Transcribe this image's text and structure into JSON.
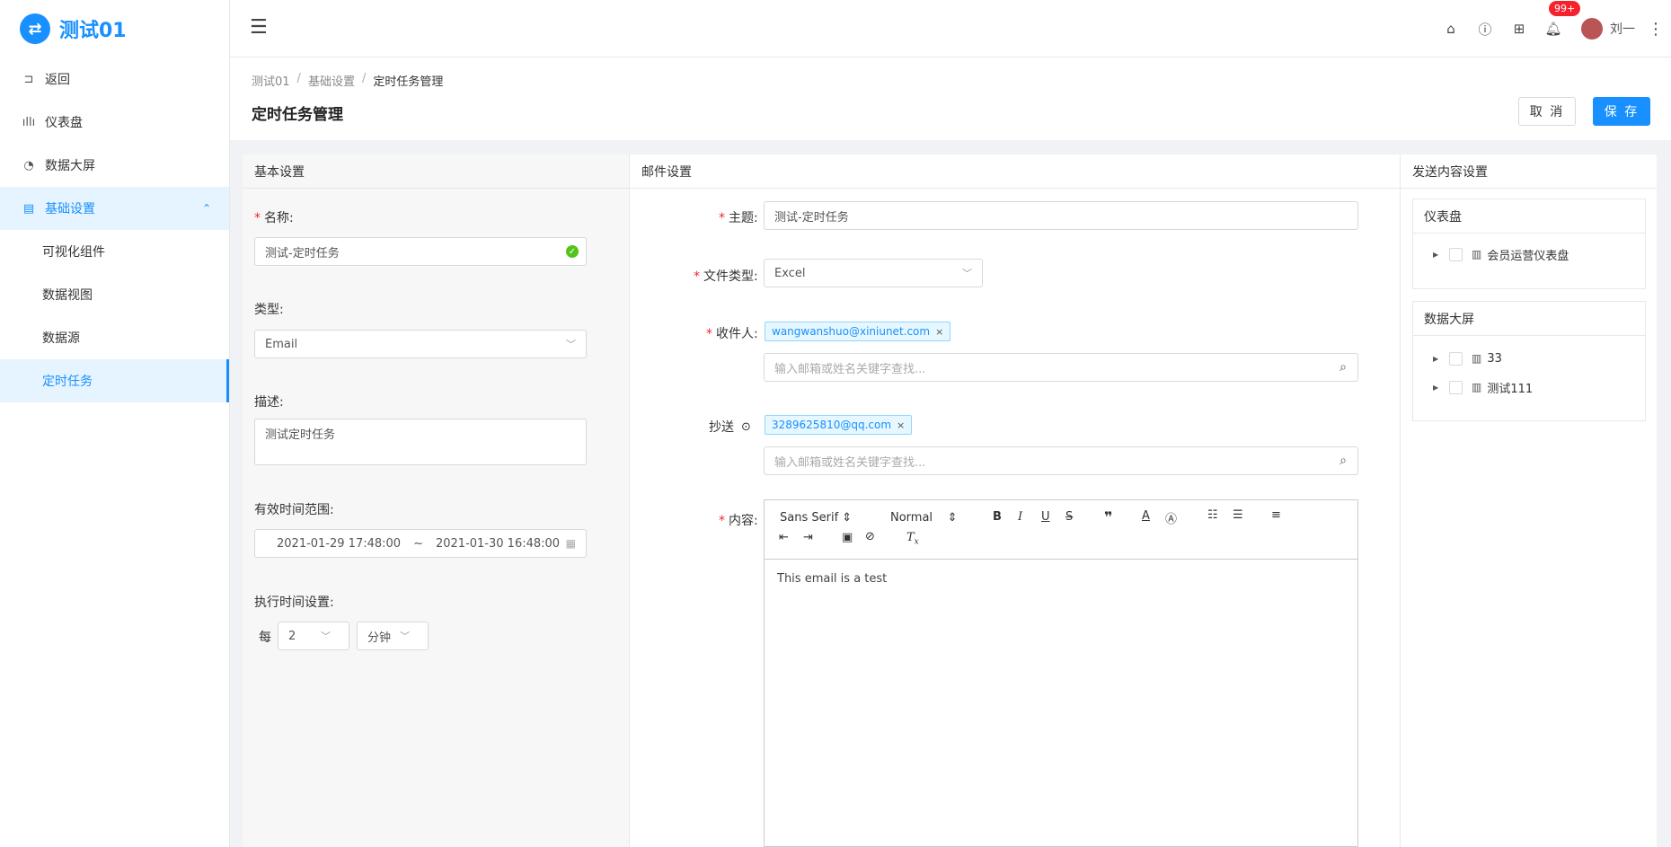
{
  "app": {
    "logo_glyph": "⇄",
    "title": "测试01"
  },
  "sidebar": {
    "items": [
      {
        "label": "返回",
        "icon": "back-icon"
      },
      {
        "label": "仪表盘",
        "icon": "dashboard-icon"
      },
      {
        "label": "数据大屏",
        "icon": "pie-chart-icon"
      },
      {
        "label": "基础设置",
        "icon": "settings-doc-icon"
      }
    ],
    "subitems": [
      "可视化组件",
      "数据视图",
      "数据源",
      "定时任务"
    ]
  },
  "header": {
    "notification_badge": "99+",
    "username": "刘一"
  },
  "breadcrumb": {
    "items": [
      "测试01",
      "基础设置",
      "定时任务管理"
    ]
  },
  "page": {
    "title": "定时任务管理",
    "cancel_label": "取 消",
    "save_label": "保 存"
  },
  "basic": {
    "header": "基本设置",
    "name_label": "名称:",
    "name_value": "测试-定时任务",
    "type_label": "类型:",
    "type_value": "Email",
    "desc_label": "描述:",
    "desc_value": "测试定时任务",
    "range_label": "有效时间范围:",
    "range_start": "2021-01-29 17:48:00",
    "range_sep": "~",
    "range_end": "2021-01-30 16:48:00",
    "exec_label": "执行时间设置:",
    "every_label": "每",
    "every_value": "2",
    "unit_value": "分钟"
  },
  "mail": {
    "header": "邮件设置",
    "subject_label": "主题:",
    "subject_value": "测试-定时任务",
    "filetype_label": "文件类型:",
    "filetype_value": "Excel",
    "to_label": "收件人:",
    "to_tag": "wangwanshuo@xiniunet.com",
    "to_placeholder": "输入邮箱或姓名关键字查找...",
    "cc_label": "抄送",
    "cc_tag": "3289625810@qq.com",
    "cc_placeholder": "输入邮箱或姓名关键字查找...",
    "content_label": "内容:",
    "font_value": "Sans Serif",
    "size_value": "Normal",
    "content_value": "This email is a test"
  },
  "send_content": {
    "header": "发送内容设置",
    "dashboard_title": "仪表盘",
    "dashboard_items": [
      "会员运营仪表盘"
    ],
    "screen_title": "数据大屏",
    "screen_items": [
      "33",
      "测试111"
    ]
  }
}
